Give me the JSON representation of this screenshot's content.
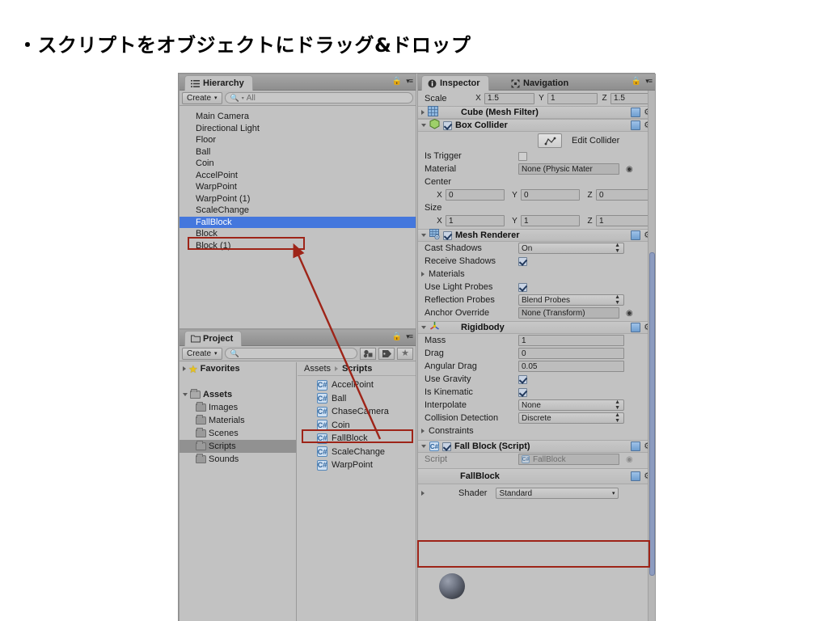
{
  "slide": {
    "title": "・スクリプトをオブジェクトにドラッグ&ドロップ"
  },
  "colors": {
    "accent_red": "#9e2418",
    "selection_blue": "#4477dd",
    "panel_bg": "#c2c2c2"
  },
  "hierarchy": {
    "tab_label": "Hierarchy",
    "tab_icon": "hierarchy-icon",
    "create_label": "Create",
    "search_placeholder": "All",
    "search_value": "",
    "lock_icon": "lock-icon",
    "menu_icon": "panel-menu-icon",
    "items": [
      {
        "label": "Main Camera",
        "selected": false
      },
      {
        "label": "Directional Light",
        "selected": false
      },
      {
        "label": "Floor",
        "selected": false
      },
      {
        "label": "Ball",
        "selected": false
      },
      {
        "label": "Coin",
        "selected": false
      },
      {
        "label": "AccelPoint",
        "selected": false
      },
      {
        "label": "WarpPoint",
        "selected": false
      },
      {
        "label": "WarpPoint (1)",
        "selected": false
      },
      {
        "label": "ScaleChange",
        "selected": false
      },
      {
        "label": "FallBlock",
        "selected": true
      },
      {
        "label": "Block",
        "selected": false
      },
      {
        "label": "Block (1)",
        "selected": false
      }
    ]
  },
  "project": {
    "tab_label": "Project",
    "tab_icon": "folder-icon",
    "create_label": "Create",
    "search_placeholder": "",
    "search_value": "",
    "toolbar_icons": [
      "object-filter-icon",
      "label-filter-icon",
      "favorite-star-icon"
    ],
    "lock_icon": "lock-icon",
    "menu_icon": "panel-menu-icon",
    "favorites_label": "Favorites",
    "tree": [
      {
        "label": "Assets",
        "depth": 0,
        "selected": false,
        "expanded": true
      },
      {
        "label": "Images",
        "depth": 1,
        "selected": false
      },
      {
        "label": "Materials",
        "depth": 1,
        "selected": false
      },
      {
        "label": "Scenes",
        "depth": 1,
        "selected": false
      },
      {
        "label": "Scripts",
        "depth": 1,
        "selected": true
      },
      {
        "label": "Sounds",
        "depth": 1,
        "selected": false
      }
    ],
    "breadcrumb": {
      "root": "Assets",
      "current": "Scripts"
    },
    "assets": [
      {
        "label": "AccelPoint",
        "icon": "csharp-script-icon"
      },
      {
        "label": "Ball",
        "icon": "csharp-script-icon"
      },
      {
        "label": "ChaseCamera",
        "icon": "csharp-script-icon"
      },
      {
        "label": "Coin",
        "icon": "csharp-script-icon"
      },
      {
        "label": "FallBlock",
        "icon": "csharp-script-icon"
      },
      {
        "label": "ScaleChange",
        "icon": "csharp-script-icon"
      },
      {
        "label": "WarpPoint",
        "icon": "csharp-script-icon"
      }
    ]
  },
  "inspector": {
    "tab_label": "Inspector",
    "tab_icon": "info-icon",
    "tab2_label": "Navigation",
    "tab2_icon": "navigation-icon",
    "lock_icon": "lock-icon",
    "menu_icon": "panel-menu-icon",
    "transform_scale": {
      "label": "Scale",
      "x_axis": "X",
      "x_value": "1.5",
      "y_axis": "Y",
      "y_value": "1",
      "z_axis": "Z",
      "z_value": "1.5"
    },
    "mesh_filter": {
      "title": "Cube (Mesh Filter)",
      "icon": "mesh-filter-icon",
      "expanded": false
    },
    "box_collider": {
      "title": "Box Collider",
      "icon": "box-collider-icon",
      "enabled": true,
      "expanded": true,
      "edit_collider_label": "Edit Collider",
      "edit_collider_icon": "edit-collider-icon",
      "is_trigger_label": "Is Trigger",
      "is_trigger_value": false,
      "material_label": "Material",
      "material_value": "None (Physic Mater",
      "center_label": "Center",
      "center": {
        "x_axis": "X",
        "x": "0",
        "y_axis": "Y",
        "y": "0",
        "z_axis": "Z",
        "z": "0"
      },
      "size_label": "Size",
      "size": {
        "x_axis": "X",
        "x": "1",
        "y_axis": "Y",
        "y": "1",
        "z_axis": "Z",
        "z": "1"
      }
    },
    "mesh_renderer": {
      "title": "Mesh Renderer",
      "icon": "mesh-renderer-icon",
      "enabled": true,
      "expanded": true,
      "cast_shadows_label": "Cast Shadows",
      "cast_shadows_value": "On",
      "receive_shadows_label": "Receive Shadows",
      "receive_shadows_value": true,
      "materials_label": "Materials",
      "use_light_probes_label": "Use Light Probes",
      "use_light_probes_value": true,
      "reflection_probes_label": "Reflection Probes",
      "reflection_probes_value": "Blend Probes",
      "anchor_override_label": "Anchor Override",
      "anchor_override_value": "None (Transform)"
    },
    "rigidbody": {
      "title": "Rigidbody",
      "icon": "rigidbody-icon",
      "expanded": true,
      "mass_label": "Mass",
      "mass_value": "1",
      "drag_label": "Drag",
      "drag_value": "0",
      "angular_drag_label": "Angular Drag",
      "angular_drag_value": "0.05",
      "use_gravity_label": "Use Gravity",
      "use_gravity_value": true,
      "is_kinematic_label": "Is Kinematic",
      "is_kinematic_value": true,
      "interpolate_label": "Interpolate",
      "interpolate_value": "None",
      "collision_detection_label": "Collision Detection",
      "collision_detection_value": "Discrete",
      "constraints_label": "Constraints"
    },
    "fall_block_script": {
      "title": "Fall Block (Script)",
      "icon": "csharp-script-icon",
      "enabled": true,
      "expanded": true,
      "script_label": "Script",
      "script_value": "FallBlock"
    },
    "material": {
      "title": "FallBlock",
      "preview_icon": "material-sphere-preview",
      "shader_label": "Shader",
      "shader_value": "Standard"
    }
  },
  "annotations": {
    "arrow_color": "#9e2418",
    "boxes": [
      {
        "name": "hierarchy-fallblock-highlight"
      },
      {
        "name": "project-fallblock-highlight"
      },
      {
        "name": "inspector-fallblock-script-highlight"
      }
    ],
    "arrow": {
      "name": "drag-drop-arrow",
      "from": "project-fallblock",
      "to": "hierarchy-fallblock"
    }
  }
}
